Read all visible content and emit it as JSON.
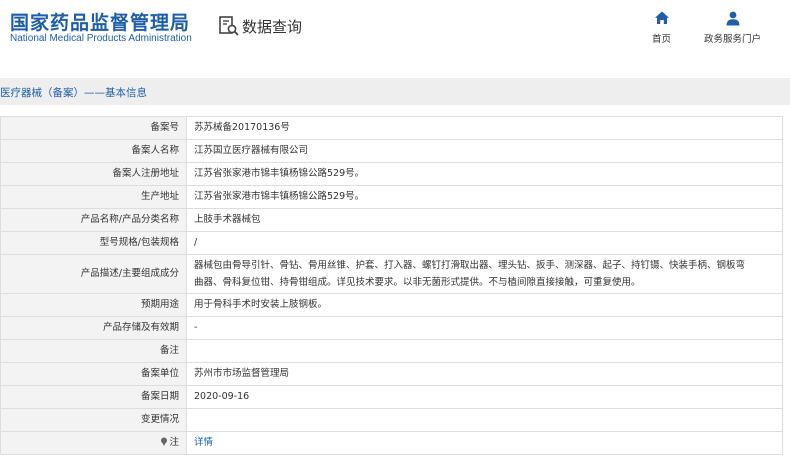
{
  "header": {
    "logo_cn": "国家药品监督管理局",
    "logo_en": "National Medical Products Administration",
    "query_label": "数据查询",
    "nav": [
      {
        "icon": "home-icon",
        "label": "首页"
      },
      {
        "icon": "user-icon",
        "label": "政务服务门户"
      }
    ]
  },
  "breadcrumb": "医疗器械（备案）——基本信息",
  "rows": [
    {
      "key": "备案号",
      "value": "苏苏械备20170136号"
    },
    {
      "key": "备案人名称",
      "value": "江苏国立医疗器械有限公司"
    },
    {
      "key": "备案人注册地址",
      "value": "江苏省张家港市锦丰镇杨锦公路529号。"
    },
    {
      "key": "生产地址",
      "value": "江苏省张家港市锦丰镇杨锦公路529号。"
    },
    {
      "key": "产品名称/产品分类名称",
      "value": "上肢手术器械包"
    },
    {
      "key": "型号规格/包装规格",
      "value": "/"
    },
    {
      "key": "产品描述/主要组成成分",
      "value_line1": "器械包由骨导引针、骨钻、骨用丝锥、护套、打入器、螺钉打滑取出器、埋头钻、扳手、测深器、起子、持钉镊、快装手柄、钢板弯",
      "value_line2": "曲器、骨科复位钳、持骨钳组成。详见技术要求。以非无菌形式提供。不与植间隙直接接触，可重复使用。"
    },
    {
      "key": "预期用途",
      "value": "用于骨科手术时安装上肢钢板。"
    },
    {
      "key": "产品存储及有效期",
      "value": "-"
    },
    {
      "key": "备注",
      "value": ""
    },
    {
      "key": "备案单位",
      "value": "苏州市市场监督管理局"
    },
    {
      "key": "备案日期",
      "value": "2020-09-16"
    },
    {
      "key": "变更情况",
      "value": ""
    },
    {
      "key": "注",
      "value": "详情"
    }
  ],
  "colors": {
    "brand_blue": "#1f5fa8",
    "bar_bg": "#eeeeee",
    "key_bg": "#f3f3f3",
    "border": "#dddddd"
  }
}
